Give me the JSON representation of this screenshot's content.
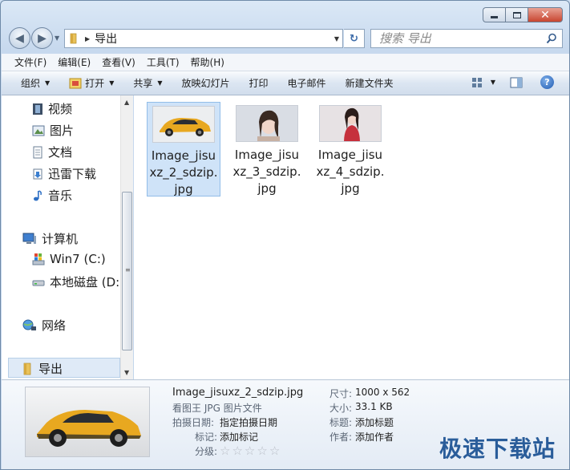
{
  "window": {
    "path": "导出"
  },
  "search": {
    "placeholder": "搜索 导出"
  },
  "menu": [
    "文件(F)",
    "编辑(E)",
    "查看(V)",
    "工具(T)",
    "帮助(H)"
  ],
  "commands": {
    "organize": "组织",
    "open": "打开",
    "share": "共享",
    "slideshow": "放映幻灯片",
    "print": "打印",
    "email": "电子邮件",
    "new_folder": "新建文件夹"
  },
  "nav": {
    "videos": "视频",
    "pictures": "图片",
    "documents": "文档",
    "thunder": "迅雷下载",
    "music": "音乐",
    "computer": "计算机",
    "drive_c": "Win7 (C:)",
    "drive_d": "本地磁盘 (D:",
    "network": "网络",
    "selected_folder": "导出"
  },
  "files": [
    {
      "name": "Image_jisuxz_2_sdzip.jpg",
      "selected": true
    },
    {
      "name": "Image_jisuxz_3_sdzip.jpg",
      "selected": false
    },
    {
      "name": "Image_jisuxz_4_sdzip.jpg",
      "selected": false
    }
  ],
  "details": {
    "filename": "Image_jisuxz_2_sdzip.jpg",
    "type": "看图王 JPG 图片文件",
    "date_taken_label": "拍摄日期:",
    "date_taken_value": "指定拍摄日期",
    "tags_label": "标记:",
    "tags_value": "添加标记",
    "rating_label": "分级:",
    "rating": 0,
    "dimensions_label": "尺寸:",
    "dimensions_value": "1000 x 562",
    "size_label": "大小:",
    "size_value": "33.1 KB",
    "title_label": "标题:",
    "title_value": "添加标题",
    "author_label": "作者:",
    "author_value": "添加作者"
  },
  "watermark": "极速下载站",
  "colors": {
    "selection": "#cfe3f8",
    "accent": "#2a5d9a"
  }
}
